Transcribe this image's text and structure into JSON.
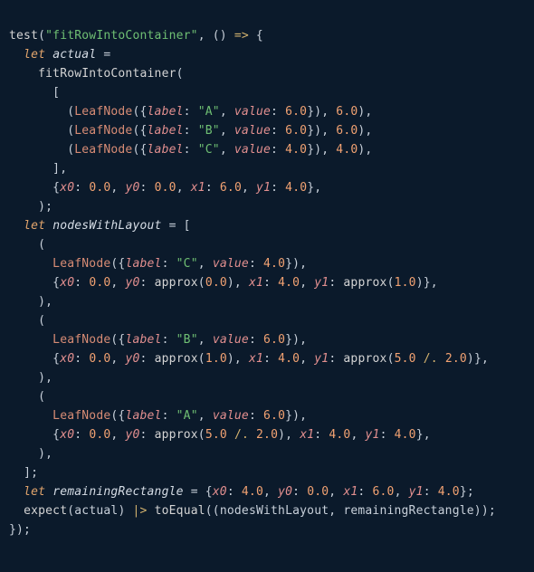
{
  "line01": {
    "fn": "test",
    "str": "\"fitRowIntoContainer\"",
    "pun1": "(",
    "pun2": ", () ",
    "op": "=>",
    "pun3": " {"
  },
  "line02": {
    "kw": "let",
    "sp": " ",
    "var": "actual",
    "eq": " ="
  },
  "line03": {
    "fn": "fitRowIntoContainer",
    "pun": "("
  },
  "line04": {
    "pun": "["
  },
  "line05": {
    "p1": "(",
    "id": "LeafNode",
    "p2": "({",
    "k1": "label",
    "c1": ": ",
    "s": "\"A\"",
    "cm": ", ",
    "k2": "value",
    "c2": ": ",
    "n1": "6.0",
    "p3": "}), ",
    "n2": "6.0",
    "p4": "),"
  },
  "line06": {
    "p1": "(",
    "id": "LeafNode",
    "p2": "({",
    "k1": "label",
    "c1": ": ",
    "s": "\"B\"",
    "cm": ", ",
    "k2": "value",
    "c2": ": ",
    "n1": "6.0",
    "p3": "}), ",
    "n2": "6.0",
    "p4": "),"
  },
  "line07": {
    "p1": "(",
    "id": "LeafNode",
    "p2": "({",
    "k1": "label",
    "c1": ": ",
    "s": "\"C\"",
    "cm": ", ",
    "k2": "value",
    "c2": ": ",
    "n1": "4.0",
    "p3": "}), ",
    "n2": "4.0",
    "p4": "),"
  },
  "line08": {
    "pun": "],"
  },
  "line09": {
    "p1": "{",
    "k1": "x0",
    "c": ": ",
    "n1": "0.0",
    "cm": ", ",
    "k2": "y0",
    "n2": "0.0",
    "k3": "x1",
    "n3": "6.0",
    "k4": "y1",
    "n4": "4.0",
    "p2": "},"
  },
  "line10": {
    "pun": ");"
  },
  "line11": {
    "kw": "let",
    "sp": " ",
    "var": "nodesWithLayout",
    "eq": " = ["
  },
  "line12": {
    "pun": "("
  },
  "line13": {
    "id": "LeafNode",
    "p1": "({",
    "k1": "label",
    "c": ": ",
    "s": "\"C\"",
    "cm": ", ",
    "k2": "value",
    "n": "4.0",
    "p2": "}),"
  },
  "line14": {
    "p1": "{",
    "k1": "x0",
    "n1": "0.0",
    "k2": "y0",
    "fn1": "approx",
    "a1": "0.0",
    "k3": "x1",
    "n3": "4.0",
    "k4": "y1",
    "fn2": "approx",
    "a2": "1.0",
    "p2": "},"
  },
  "line15": {
    "pun": "),"
  },
  "line16": {
    "pun": "("
  },
  "line17": {
    "id": "LeafNode",
    "p1": "({",
    "k1": "label",
    "c": ": ",
    "s": "\"B\"",
    "cm": ", ",
    "k2": "value",
    "n": "6.0",
    "p2": "}),"
  },
  "line18": {
    "p1": "{",
    "k1": "x0",
    "n1": "0.0",
    "k2": "y0",
    "fn1": "approx",
    "a1": "1.0",
    "k3": "x1",
    "n3": "4.0",
    "k4": "y1",
    "fn2": "approx",
    "a2a": "5.0",
    "op": "/.",
    "a2b": "2.0",
    "p2": "},"
  },
  "line19": {
    "pun": "),"
  },
  "line20": {
    "pun": "("
  },
  "line21": {
    "id": "LeafNode",
    "p1": "({",
    "k1": "label",
    "c": ": ",
    "s": "\"A\"",
    "cm": ", ",
    "k2": "value",
    "n": "6.0",
    "p2": "}),"
  },
  "line22": {
    "p1": "{",
    "k1": "x0",
    "n1": "0.0",
    "k2": "y0",
    "fn1": "approx",
    "a1a": "5.0",
    "op": "/.",
    "a1b": "2.0",
    "k3": "x1",
    "n3": "4.0",
    "k4": "y1",
    "n4": "4.0",
    "p2": "},"
  },
  "line23": {
    "pun": "),"
  },
  "line24": {
    "pun": "];"
  },
  "line25": {
    "kw": "let",
    "sp": " ",
    "var": "remainingRectangle",
    "eq": " = {",
    "k1": "x0",
    "n1": "4.0",
    "k2": "y0",
    "n2": "0.0",
    "k3": "x1",
    "n3": "6.0",
    "k4": "y1",
    "n4": "4.0",
    "p2": "};"
  },
  "line26": {
    "fn1": "expect",
    "p1": "(",
    "v1": "actual",
    "p2": ") ",
    "op": "|>",
    "sp": " ",
    "fn2": "toEqual",
    "p3": "((",
    "v2": "nodesWithLayout",
    "cm": ", ",
    "v3": "remainingRectangle",
    "p4": "));"
  },
  "line27": {
    "pun": "});"
  }
}
